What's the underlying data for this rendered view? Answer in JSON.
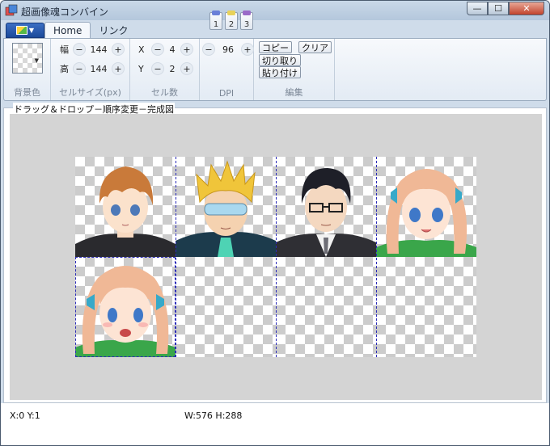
{
  "window": {
    "title": "超画像魂コンバイン"
  },
  "quick_access": [
    "1",
    "2",
    "3"
  ],
  "tabs": [
    {
      "label": "Home",
      "active": true
    },
    {
      "label": "リンク",
      "active": false
    }
  ],
  "ribbon": {
    "background": {
      "label": "背景色"
    },
    "cell_size": {
      "label": "セルサイズ(px)",
      "width_label": "幅",
      "width_value": "144",
      "height_label": "高",
      "height_value": "144"
    },
    "cell_count": {
      "label": "セル数",
      "x_label": "X",
      "x_value": "4",
      "y_label": "Y",
      "y_value": "2"
    },
    "dpi": {
      "label": "DPI",
      "value": "96"
    },
    "edit": {
      "label": "編集",
      "copy": "コピー",
      "clear": "クリア",
      "cut": "切り取り",
      "paste": "貼り付け"
    },
    "minus": "−",
    "plus": "+"
  },
  "canvas": {
    "label": "ドラッグ＆ドロップ－順序変更－完成図",
    "columns": 4,
    "rows": 2,
    "cells": [
      {
        "portrait": "brown-hair-boy"
      },
      {
        "portrait": "blond-spiky-visor"
      },
      {
        "portrait": "black-hair-glasses-suit"
      },
      {
        "portrait": "pink-hair-girl-smile"
      },
      {
        "portrait": "pink-hair-girl-open-mouth"
      },
      {
        "portrait": "empty"
      },
      {
        "portrait": "empty"
      },
      {
        "portrait": "empty"
      }
    ]
  },
  "status": {
    "cursor": "X:0 Y:1",
    "size": "W:576 H:288"
  },
  "colors": {
    "accent": "#2b2bb8",
    "canvas_bg": "#d4d4d4",
    "close": "#c2432c"
  }
}
